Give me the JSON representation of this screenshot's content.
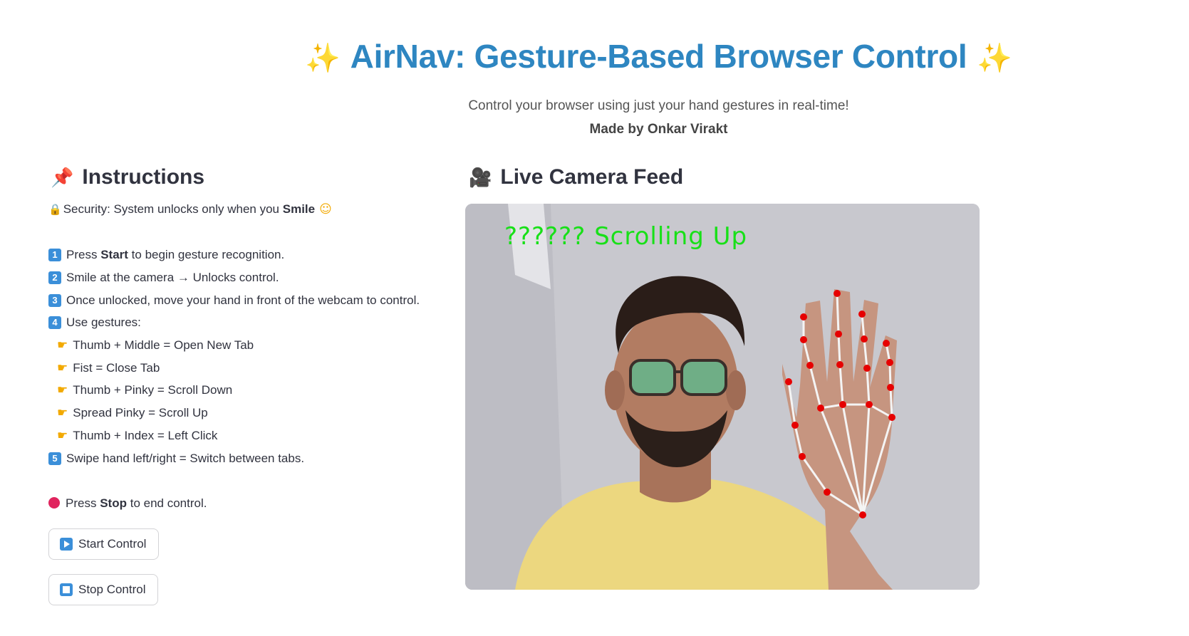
{
  "header": {
    "title": "AirNav: Gesture-Based Browser Control",
    "sparkle_icon": "✨",
    "subtitle": "Control your browser using just your hand gestures in real-time!",
    "credit": "Made by Onkar Virakt"
  },
  "instructions": {
    "heading": "Instructions",
    "heading_icon": "📌",
    "security_prefix": "Security: System unlocks only when you",
    "security_bold": "Smile",
    "steps": [
      {
        "num": "1",
        "prefix": "Press",
        "bold": "Start",
        "suffix": "to begin gesture recognition."
      },
      {
        "num": "2",
        "text": "Smile at the camera → Unlocks control."
      },
      {
        "num": "3",
        "text": "Once unlocked, move your hand in front of the webcam to control."
      },
      {
        "num": "4",
        "text": "Use gestures:"
      }
    ],
    "gestures": [
      "Thumb + Middle = Open New Tab",
      "Fist = Close Tab",
      "Thumb + Pinky = Scroll Down",
      "Spread Pinky = Scroll Up",
      "Thumb + Index = Left Click"
    ],
    "step5": {
      "num": "5",
      "text": "Swipe hand left/right = Switch between tabs."
    },
    "stop_note": {
      "prefix": "Press",
      "bold": "Stop",
      "suffix": "to end control."
    }
  },
  "buttons": {
    "start_label": "Start Control",
    "stop_label": "Stop Control"
  },
  "camera": {
    "heading": "Live Camera Feed",
    "heading_icon": "🎥",
    "overlay_text": "?????? Scrolling Up"
  },
  "colors": {
    "title": "#2e86c1",
    "button_icon": "#3b8fd9",
    "overlay_text": "#18e018",
    "landmark": "#e60000"
  }
}
